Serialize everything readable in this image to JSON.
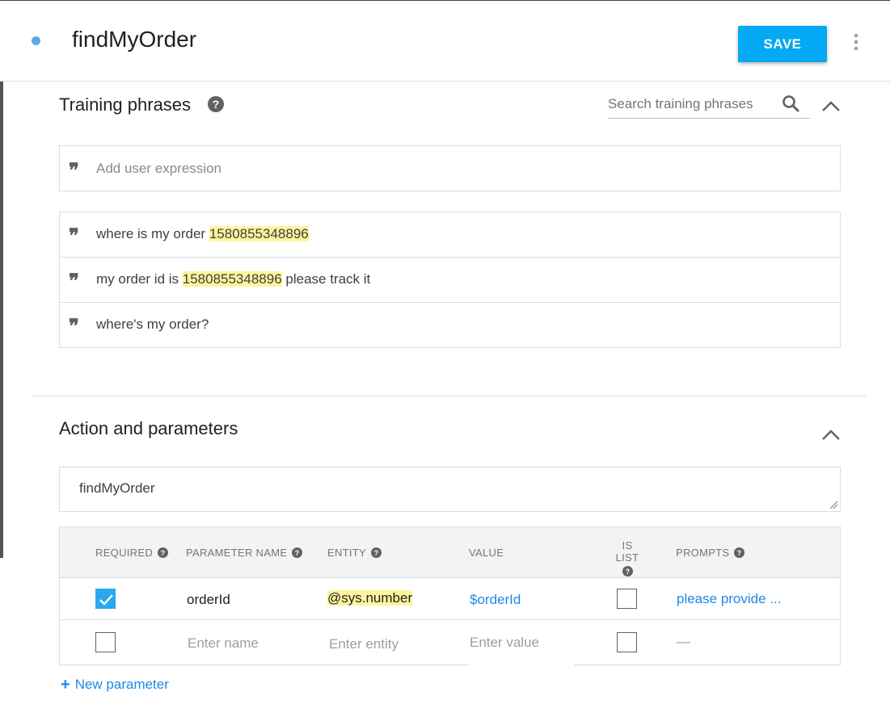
{
  "header": {
    "intent_title": "findMyOrder",
    "save_label": "SAVE",
    "accent_color": "#03a9f4"
  },
  "training": {
    "title": "Training phrases",
    "search_placeholder": "Search training phrases",
    "add_placeholder": "Add user expression",
    "phrases": [
      {
        "before": "where is my order ",
        "highlight": "1580855348896",
        "after": ""
      },
      {
        "before": "my order id is ",
        "highlight": "1580855348896",
        "after": " please track it"
      },
      {
        "before": "where's my order?",
        "highlight": "",
        "after": ""
      }
    ],
    "highlight_color": "#fff59d"
  },
  "action": {
    "title": "Action and parameters",
    "action_name": "findMyOrder"
  },
  "parameters": {
    "headers": {
      "required": "REQUIRED",
      "name": "PARAMETER NAME",
      "entity": "ENTITY",
      "value": "VALUE",
      "is_list": "IS LIST",
      "prompts": "PROMPTS"
    },
    "rows": [
      {
        "required": true,
        "name": "orderId",
        "entity": "@sys.number",
        "value": "$orderId",
        "is_list": false,
        "prompts": "please provide ..."
      }
    ],
    "empty_row": {
      "required": false,
      "name_placeholder": "Enter name",
      "entity_placeholder": "Enter entity",
      "value_placeholder": "Enter value",
      "is_list": false,
      "prompts": "—"
    },
    "new_parameter_label": "New parameter"
  }
}
